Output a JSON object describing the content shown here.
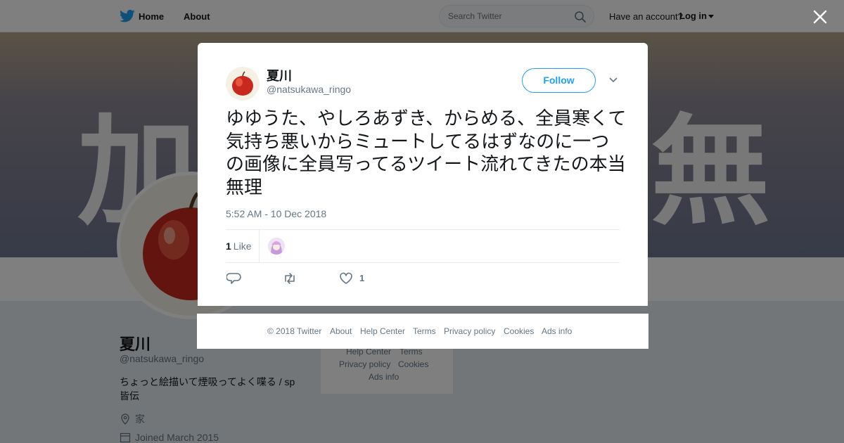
{
  "nav": {
    "home_label": "Home",
    "about_label": "About",
    "search_placeholder": "Search Twitter",
    "have_account": "Have an account?",
    "login_label": "Log in",
    "accent_color": "#1da1f2"
  },
  "banner": {
    "left_glyph": "加",
    "right_glyph": "無"
  },
  "profile": {
    "name": "夏川",
    "handle": "@natsukawa_ringo",
    "bio": "ちょっと絵描いて煙吸ってよく喋る / sp 皆伝",
    "location": "家",
    "joined": "Joined March 2015"
  },
  "side_footer": {
    "help_center": "Help Center",
    "terms": "Terms",
    "privacy": "Privacy policy",
    "cookies": "Cookies",
    "ads_info": "Ads info"
  },
  "tweet": {
    "name": "夏川",
    "handle": "@natsukawa_ringo",
    "follow_label": "Follow",
    "text": "ゆゆうた、やしろあずき、からめる、全員寒くて気持ち悪いからミュートしてるはずなのに一つの画像に全員写ってるツイート流れてきたの本当無理",
    "timestamp": "5:52 AM - 10 Dec 2018",
    "likes_count": "1",
    "likes_label": "Like",
    "like_action_count": "1"
  },
  "footer": {
    "copyright": "© 2018 Twitter",
    "about": "About",
    "help_center": "Help Center",
    "terms": "Terms",
    "privacy": "Privacy policy",
    "cookies": "Cookies",
    "ads_info": "Ads info"
  },
  "icons": [
    "twitter-bird-icon",
    "search-icon",
    "close-icon",
    "chevron-down-icon",
    "reply-icon",
    "retweet-icon",
    "heart-icon",
    "location-icon",
    "calendar-icon"
  ]
}
